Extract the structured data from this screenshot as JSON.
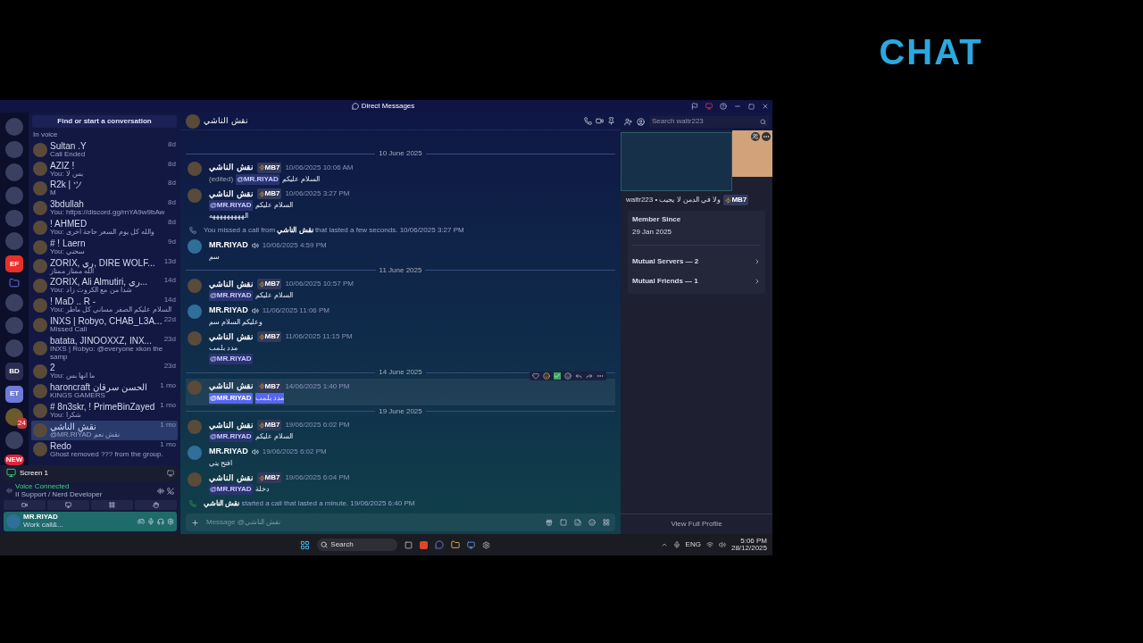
{
  "window": {
    "title": "Direct Messages"
  },
  "servers": [
    {
      "kind": "plain"
    },
    {
      "kind": "plain"
    },
    {
      "kind": "plain"
    },
    {
      "kind": "plain"
    },
    {
      "kind": "plain"
    },
    {
      "kind": "plain"
    },
    {
      "kind": "text",
      "label": "EF",
      "color": "#e8302a"
    },
    {
      "kind": "folder"
    },
    {
      "kind": "plain"
    },
    {
      "kind": "plain"
    },
    {
      "kind": "plain"
    },
    {
      "kind": "text",
      "label": "BD",
      "color": "#2b2d52"
    },
    {
      "kind": "text",
      "label": "ET",
      "color": "#6f7bd8"
    },
    {
      "kind": "badge",
      "label": "24",
      "color": "#d0303a"
    },
    {
      "kind": "plain"
    },
    {
      "kind": "new",
      "label": "NEW",
      "color": "#e0243a"
    }
  ],
  "dm_search": {
    "placeholder": "Find or start a conversation"
  },
  "dms": [
    {
      "preview": "In voice",
      "selected": false
    },
    {
      "name": "Sultan .Y",
      "preview": "Call Ended",
      "time": "8d",
      "selected": false
    },
    {
      "name": "AZIZ !",
      "preview": "You: بس لا",
      "time": "8d",
      "selected": false
    },
    {
      "name": "R2k | ツ",
      "preview": "M",
      "time": "8d",
      "selected": false
    },
    {
      "name": "3bdullah",
      "preview": "You: https://discord.gg/rnYA9w9bAw",
      "time": "8d",
      "selected": false
    },
    {
      "name": "! AHMED",
      "preview": "You: والله كل يوم السعر حاجة اخرى",
      "time": "8d",
      "selected": false
    },
    {
      "name": "# ! Laern",
      "preview": "You: سحني",
      "time": "9d",
      "selected": false
    },
    {
      "name": "ZORIX, ري, DIRE WOLF...",
      "preview": "الله ممتاز ممتاز",
      "time": "13d",
      "selected": false
    },
    {
      "name": "ZORIX, Ali Almutiri, ري...",
      "preview": "You: شدا من مع الكروت زاد",
      "time": "14d",
      "selected": false
    },
    {
      "name": "! MaD .. R -",
      "preview": "You: السلام عليكم الصفر مساني كل ماطر",
      "time": "14d",
      "selected": false
    },
    {
      "name": "INXS | Robyo, CHAB_L3A...",
      "preview": "Missed Call",
      "time": "22d",
      "selected": false
    },
    {
      "name": "batata, JINOOXXZ, INX...",
      "preview": "INXS | Robyo: @everyone xkon the samp",
      "time": "23d",
      "selected": false
    },
    {
      "name": "2",
      "preview": "You: ما انها بس",
      "time": "23d",
      "selected": false
    },
    {
      "name": "haroncraft الحسن سرقان",
      "preview": "KINGS GAMERS",
      "time": "1 mo",
      "selected": false
    },
    {
      "name": "# 8n3skr, ! PrimeBinZayed",
      "preview": "You: شكرا",
      "time": "1 mo",
      "selected": false
    },
    {
      "name": "نقش الناشي",
      "preview": "@MR.RIYAD نقش نعم",
      "time": "1 mo",
      "selected": true
    },
    {
      "name": "Redo",
      "preview": "Ghost removed ??? from the group.",
      "time": "1 mo",
      "selected": false
    }
  ],
  "screen_share": {
    "label": "Screen 1"
  },
  "voice": {
    "status": "Voice Connected",
    "channel": "II Support / Nerd Developer"
  },
  "user": {
    "name": "MR.RIYAD",
    "status": "Work call&..."
  },
  "chat": {
    "recipient": "نقش الناشي",
    "search": {
      "placeholder": "Search waltr223"
    },
    "items": [
      {
        "kind": "date",
        "text": "10 June 2025"
      },
      {
        "kind": "message",
        "author": "نقش الناشي",
        "tag": "MB7",
        "speaker": false,
        "time": "10/06/2025 10:06 AM",
        "hovered": false,
        "lines": [
          {
            "prefix": "(edited)",
            "mention": "@MR.RIYAD",
            "text": "السلام عليكم",
            "selected": false
          }
        ]
      },
      {
        "kind": "message",
        "author": "نقش الناشي",
        "tag": "MB7",
        "speaker": false,
        "time": "10/06/2025 3:27 PM",
        "hovered": false,
        "lines": [
          {
            "mention": "@MR.RIYAD",
            "text": "السلام عليكم",
            "selected": false
          },
          {
            "text": "الهههههههههه",
            "selected": false
          }
        ]
      },
      {
        "kind": "missed",
        "before": "You missed a call from",
        "who": "نقش الناشي",
        "after": "that lasted a few seconds.",
        "time": "10/06/2025 3:27 PM"
      },
      {
        "kind": "message",
        "author": "MR.RIYAD",
        "speaker": true,
        "time": "10/06/2025 4:59 PM",
        "hovered": false,
        "lines": [
          {
            "text": "سم",
            "selected": false
          }
        ]
      },
      {
        "kind": "date",
        "text": "11 June 2025"
      },
      {
        "kind": "message",
        "author": "نقش الناشي",
        "tag": "MB7",
        "speaker": false,
        "time": "10/06/2025 10:57 PM",
        "hovered": false,
        "lines": [
          {
            "mention": "@MR.RIYAD",
            "text": "السلام عليكم",
            "selected": false
          }
        ]
      },
      {
        "kind": "message",
        "author": "MR.RIYAD",
        "speaker": true,
        "time": "11/06/2025 11:06 PM",
        "hovered": false,
        "lines": [
          {
            "text": "وعليكم السلام سم",
            "selected": false
          }
        ]
      },
      {
        "kind": "message",
        "author": "نقش الناشي",
        "tag": "MB7",
        "speaker": false,
        "time": "11/06/2025 11:15 PM",
        "hovered": false,
        "lines": [
          {
            "text": "مدد بلمب",
            "selected": false
          },
          {
            "mention": "@MR.RIYAD",
            "selected": false
          }
        ]
      },
      {
        "kind": "date",
        "text": "14 June 2025"
      },
      {
        "kind": "message",
        "author": "نقش الناشي",
        "tag": "MB7",
        "speaker": false,
        "time": "14/06/2025 1:40 PM",
        "hovered": true,
        "lines": [
          {
            "mention": "@MR.RIYAD",
            "text": "مدد بلمب",
            "selected": true
          }
        ]
      },
      {
        "kind": "date",
        "text": "19 June 2025"
      },
      {
        "kind": "message",
        "author": "نقش الناشي",
        "tag": "MB7",
        "speaker": false,
        "time": "19/06/2025 6:02 PM",
        "hovered": false,
        "lines": [
          {
            "mention": "@MR.RIYAD",
            "text": "السلام عليكم",
            "selected": false
          }
        ]
      },
      {
        "kind": "message",
        "author": "MR.RIYAD",
        "speaker": true,
        "time": "19/06/2025 6:02 PM",
        "hovered": false,
        "lines": [
          {
            "text": "افتح يتي",
            "selected": false
          }
        ]
      },
      {
        "kind": "message",
        "author": "نقش الناشي",
        "tag": "MB7",
        "speaker": false,
        "time": "19/06/2025 6:04 PM",
        "hovered": false,
        "lines": [
          {
            "mention": "@MR.RIYAD",
            "text": "دخلة",
            "selected": false
          }
        ]
      },
      {
        "kind": "call",
        "who": "نقش الناشي",
        "after": "started a call that lasted a minute.",
        "time": "19/06/2025 6:40 PM"
      }
    ],
    "composer": {
      "placeholder": "Message @نقش الناشي"
    }
  },
  "profile": {
    "username": "waltr223 • ولا في الدمن لا يجيب",
    "tag": "MB7",
    "member_since_label": "Member Since",
    "member_since": "29 Jan 2025",
    "links": [
      "Mutual Servers — 2",
      "Mutual Friends — 1"
    ],
    "view_full": "View Full Profile"
  },
  "taskbar": {
    "search": "Search",
    "lang": "ENG",
    "time": "5:06 PM",
    "date": "28/12/2025"
  },
  "overlay": {
    "logo": "CHAT"
  }
}
